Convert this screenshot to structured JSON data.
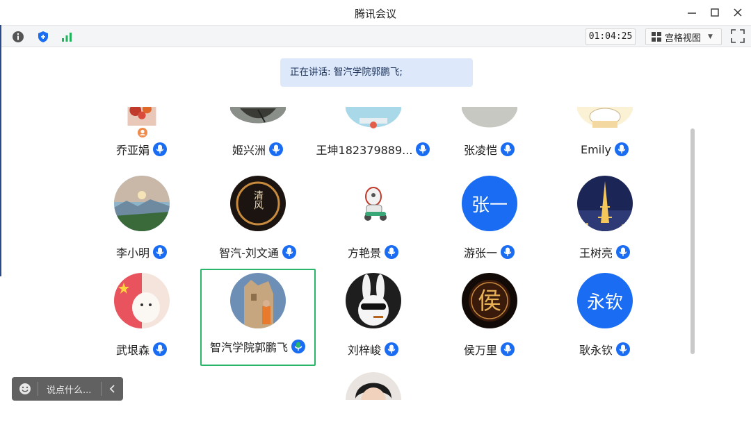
{
  "window": {
    "title": "腾讯会议"
  },
  "toolbar": {
    "timer": "01:04:25",
    "view_label": "宫格视图",
    "signal_color": "#21b35b"
  },
  "speaking": {
    "text": "正在讲话: 智汽学院郭鹏飞;"
  },
  "participants": [
    {
      "name": "乔亚娟",
      "avatar": "photo-flowers"
    },
    {
      "name": "姬兴洲",
      "avatar": "photo-sky"
    },
    {
      "name": "王坤182379889...",
      "avatar": "photo-bunny-pale"
    },
    {
      "name": "张凌恺",
      "avatar": "photo-grey"
    },
    {
      "name": "Emily",
      "avatar": "photo-cartoon-cat"
    },
    {
      "name": "李小明",
      "avatar": "photo-landscape"
    },
    {
      "name": "智汽-刘文通",
      "avatar": "photo-calligraphy",
      "avatar_text": "清风"
    },
    {
      "name": "方艳景",
      "avatar": "photo-ultraman-scooter"
    },
    {
      "name": "游张一",
      "avatar": "text-avatar",
      "avatar_text": "张一"
    },
    {
      "name": "王树亮",
      "avatar": "photo-eiffel-tower"
    },
    {
      "name": "武垠森",
      "avatar": "photo-dog-flag"
    },
    {
      "name": "智汽学院郭鹏飞",
      "avatar": "photo-desert-person",
      "active": true
    },
    {
      "name": "刘梓峻",
      "avatar": "photo-rabbit-sunglasses"
    },
    {
      "name": "侯万里",
      "avatar": "photo-hou-gold",
      "avatar_text": "侯"
    },
    {
      "name": "耿永钦",
      "avatar": "text-avatar",
      "avatar_text": "永钦"
    },
    {
      "name": "",
      "avatar": "photo-person-partial"
    }
  ],
  "chat": {
    "placeholder": "说点什么..."
  },
  "colors": {
    "accent_blue": "#1a6df2",
    "active_border": "#2ab66a",
    "mic_active": "#2ab66a"
  }
}
